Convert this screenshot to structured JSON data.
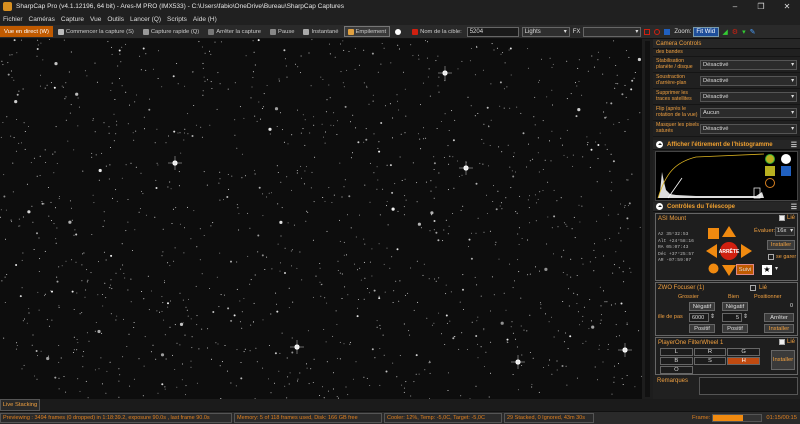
{
  "window": {
    "title": "SharpCap Pro (v4.1.12196, 64 bit) - Ares-M PRO (IMX533) - C:\\Users\\fabio\\OneDrive\\Bureau\\SharpCap Captures",
    "minimize": "–",
    "maximize": "❐",
    "close": "✕"
  },
  "menu": [
    "Fichier",
    "Caméras",
    "Capture",
    "Vue",
    "Outils",
    "Lancer (Q)",
    "Scripts",
    "Aide (H)"
  ],
  "toolbar": {
    "live": "Vue en direct (W)",
    "start": "Commencer la capture (S)",
    "quick": "Capture rapide (Q)",
    "stop": "Arrêter la capture",
    "pause": "Pause",
    "snapshot": "Instantané",
    "stacking": "Empilement",
    "target_label": "Nom de la cible:",
    "target_value": "5204",
    "frame_type": "Lights",
    "fx_label": "FX",
    "zoom_label": "Zoom:",
    "zoom_value": "Fit Wid"
  },
  "camera_controls": {
    "title": "Camera Controls",
    "partial_label": "des bandes",
    "rows": [
      {
        "label": "Stabilisation planète / disque",
        "value": "Désactivé"
      },
      {
        "label": "Soustraction d'arrière-plan",
        "value": "Désactivé"
      },
      {
        "label": "Supprimer les traces satellites",
        "value": "Désactivé"
      },
      {
        "label": "Flip (après le rotation de la vue)",
        "value": "Aucun"
      },
      {
        "label": "Masquer les pixels saturés",
        "value": "Désactivé"
      }
    ]
  },
  "histogram": {
    "title": "Afficher l'étirement de l'histogramme"
  },
  "telescope": {
    "title": "Contrôles du Télescope",
    "mount": "ASI Mount",
    "link_label": "Lié",
    "evaluate_label": "Évaluer:",
    "rate": "16x",
    "install": "Installer",
    "coords": [
      {
        "k": "Az",
        "v": "35°32:53"
      },
      {
        "k": "Alt",
        "v": "+24°58:16"
      },
      {
        "k": "RA",
        "v": "05:07:43"
      },
      {
        "k": "Déc",
        "v": "+37°25:57"
      },
      {
        "k": "AR",
        "v": "-07:59:07"
      }
    ],
    "stop": "ARRÊTE",
    "follow": "Suivi",
    "park": "se garer"
  },
  "focuser": {
    "title": "ZWO Focuser (1)",
    "link_label": "Lié",
    "coarse": "Grossier",
    "fine": "Bien",
    "position": "Positionner",
    "position_value": "0",
    "neg": "Négatif",
    "step_label": "ille de pas",
    "coarse_step": "6000",
    "fine_step": "5",
    "stop": "Arrêter",
    "pos": "Positif",
    "install": "Installer"
  },
  "filterwheel": {
    "title": "PlayerOne FilterWheel 1",
    "link_label": "Lié",
    "filters": [
      "L",
      "R",
      "G",
      "B",
      "S",
      "H",
      "O"
    ],
    "selected": "H",
    "install": "Installer"
  },
  "remarks": {
    "label": "Remarques"
  },
  "livestack_tab": "Live Stacking",
  "status": {
    "preview": "Previewing : 3494 frames (0 dropped) in 1:18:39.2, exposure 90.0s , last frame 90.0s",
    "memory": "Memory: 5 of 118 frames used, Disk: 166 GB free",
    "cooler": "Cooler: 12%, Temp: -5,0C, Target: -5,0C",
    "stacked": "29 Stacked, 0 Ignored, 43m 30s",
    "frame_label": "Frame:",
    "frame_progress": 0.62,
    "time": "01:15/00:15"
  },
  "colors": {
    "accent": "#f0a040",
    "active": "#c05a00",
    "stop_red": "#d02010",
    "arrow": "#f08a10"
  }
}
